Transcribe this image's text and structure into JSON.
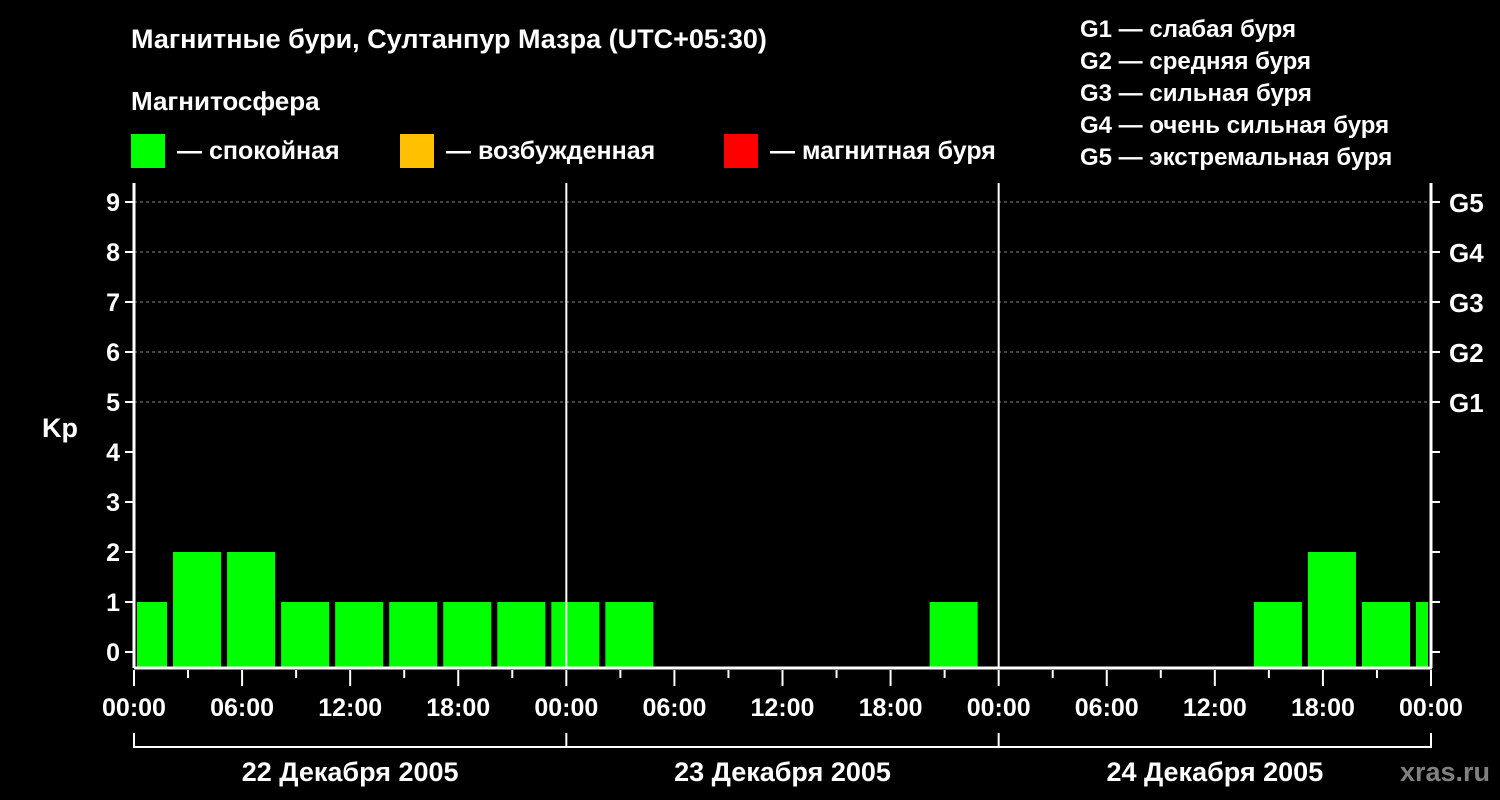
{
  "title": "Магнитные бури, Султанпур Мазра (UTC+05:30)",
  "subtitle": "Магнитосфера",
  "legend": [
    {
      "label": "— спокойная",
      "color": "#00ff00"
    },
    {
      "label": "— возбужденная",
      "color": "#ffc000"
    },
    {
      "label": "— магнитная буря",
      "color": "#ff0000"
    }
  ],
  "g_scale": [
    "G1 — слабая буря",
    "G2 — средняя буря",
    "G3 — сильная буря",
    "G4 — очень сильная буря",
    "G5 — экстремальная буря"
  ],
  "watermark": "xras.ru",
  "chart_data": {
    "type": "bar",
    "ylabel": "Kp",
    "ylim": [
      0,
      9
    ],
    "yticks": [
      "0",
      "1",
      "2",
      "3",
      "4",
      "5",
      "6",
      "7",
      "8",
      "9"
    ],
    "right_ticks": [
      {
        "kp": 5,
        "label": "G1"
      },
      {
        "kp": 6,
        "label": "G2"
      },
      {
        "kp": 7,
        "label": "G3"
      },
      {
        "kp": 8,
        "label": "G4"
      },
      {
        "kp": 9,
        "label": "G5"
      }
    ],
    "xlim_hours": [
      0,
      72
    ],
    "xtick_labels": [
      "00:00",
      "06:00",
      "12:00",
      "18:00",
      "00:00",
      "06:00",
      "12:00",
      "18:00",
      "00:00",
      "06:00",
      "12:00",
      "18:00",
      "00:00"
    ],
    "days": [
      "22 Декабря 2005",
      "23 Декабря 2005",
      "24 Декабря 2005"
    ],
    "grid": "dashed at integer Kp 5-9",
    "bars": [
      {
        "start": 0,
        "end": 2,
        "kp": 1
      },
      {
        "start": 2,
        "end": 5,
        "kp": 2
      },
      {
        "start": 5,
        "end": 8,
        "kp": 2
      },
      {
        "start": 8,
        "end": 11,
        "kp": 1
      },
      {
        "start": 11,
        "end": 14,
        "kp": 1
      },
      {
        "start": 14,
        "end": 17,
        "kp": 1
      },
      {
        "start": 17,
        "end": 20,
        "kp": 1
      },
      {
        "start": 20,
        "end": 23,
        "kp": 1
      },
      {
        "start": 23,
        "end": 26,
        "kp": 1
      },
      {
        "start": 26,
        "end": 29,
        "kp": 1
      },
      {
        "start": 29,
        "end": 32,
        "kp": 0
      },
      {
        "start": 32,
        "end": 35,
        "kp": 0
      },
      {
        "start": 35,
        "end": 38,
        "kp": 0
      },
      {
        "start": 38,
        "end": 41,
        "kp": 0
      },
      {
        "start": 41,
        "end": 44,
        "kp": 0
      },
      {
        "start": 44,
        "end": 47,
        "kp": 1
      },
      {
        "start": 47,
        "end": 50,
        "kp": 0
      },
      {
        "start": 50,
        "end": 53,
        "kp": 0
      },
      {
        "start": 53,
        "end": 56,
        "kp": 0
      },
      {
        "start": 56,
        "end": 59,
        "kp": 0
      },
      {
        "start": 59,
        "end": 62,
        "kp": 0
      },
      {
        "start": 62,
        "end": 65,
        "kp": 1
      },
      {
        "start": 65,
        "end": 68,
        "kp": 2
      },
      {
        "start": 68,
        "end": 71,
        "kp": 1
      },
      {
        "start": 71,
        "end": 72,
        "kp": 1
      }
    ]
  }
}
